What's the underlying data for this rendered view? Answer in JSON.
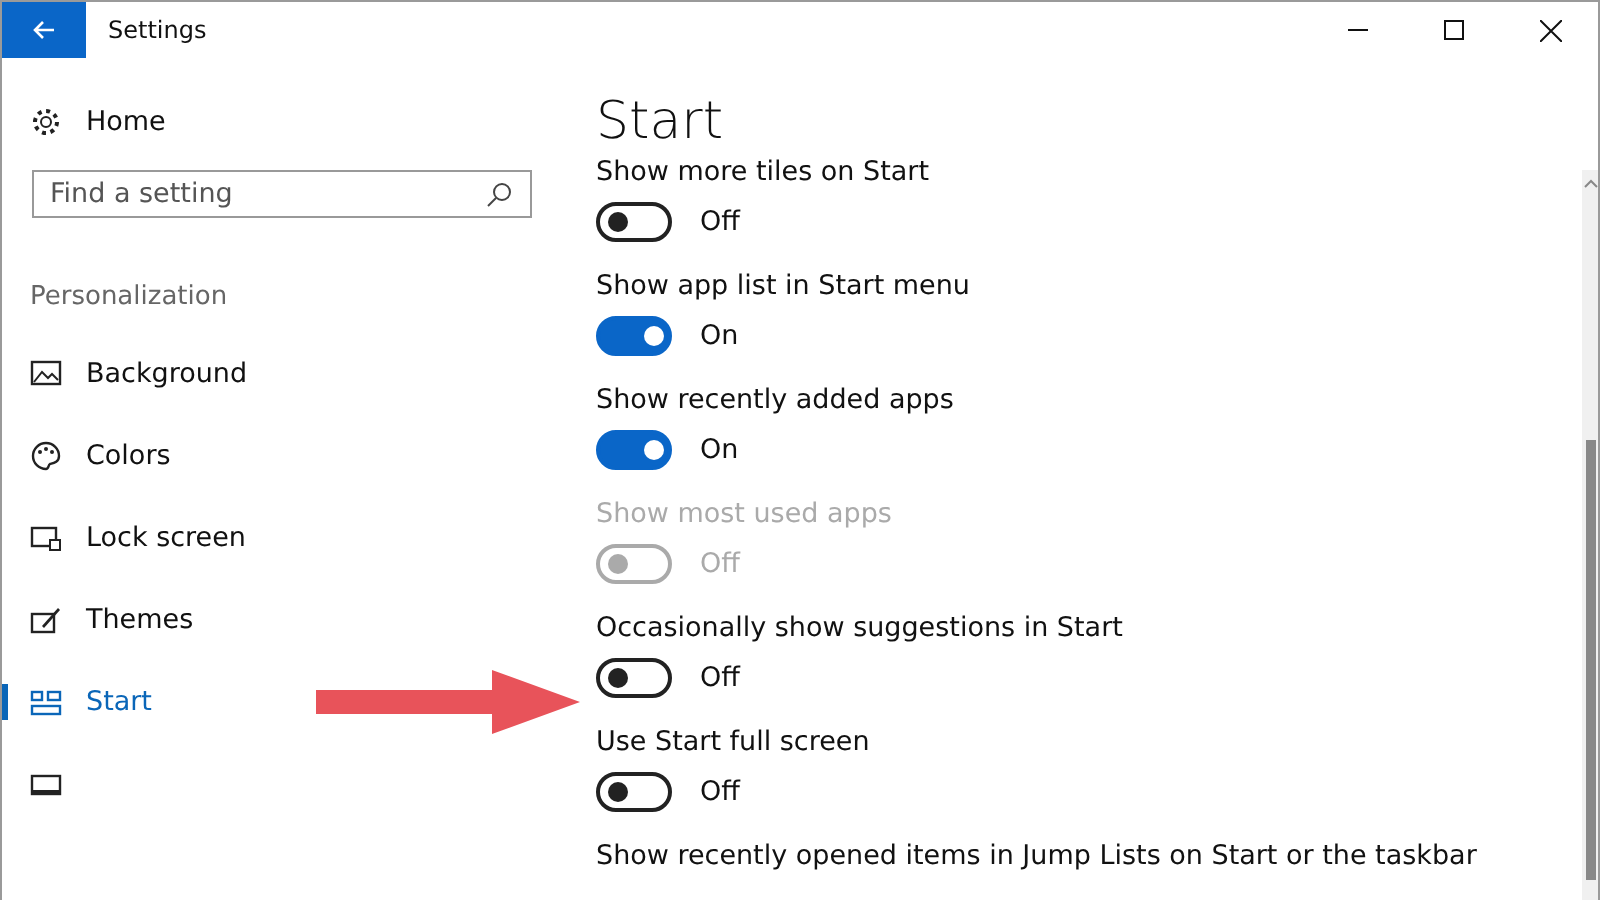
{
  "window": {
    "title": "Settings"
  },
  "sidebar": {
    "home": "Home",
    "search": {
      "placeholder": "Find a setting"
    },
    "section": "Personalization",
    "items": [
      {
        "label": "Background",
        "selected": false
      },
      {
        "label": "Colors",
        "selected": false
      },
      {
        "label": "Lock screen",
        "selected": false
      },
      {
        "label": "Themes",
        "selected": false
      },
      {
        "label": "Start",
        "selected": true
      }
    ]
  },
  "page": {
    "title": "Start",
    "settings": [
      {
        "label": "Show more tiles on Start",
        "on": false,
        "disabled": false,
        "state": "Off"
      },
      {
        "label": "Show app list in Start menu",
        "on": true,
        "disabled": false,
        "state": "On"
      },
      {
        "label": "Show recently added apps",
        "on": true,
        "disabled": false,
        "state": "On"
      },
      {
        "label": "Show most used apps",
        "on": false,
        "disabled": true,
        "state": "Off"
      },
      {
        "label": "Occasionally show suggestions in Start",
        "on": false,
        "disabled": false,
        "state": "Off"
      },
      {
        "label": "Use Start full screen",
        "on": false,
        "disabled": false,
        "state": "Off"
      },
      {
        "label": "Show recently opened items in Jump Lists on Start or the taskbar"
      }
    ]
  }
}
